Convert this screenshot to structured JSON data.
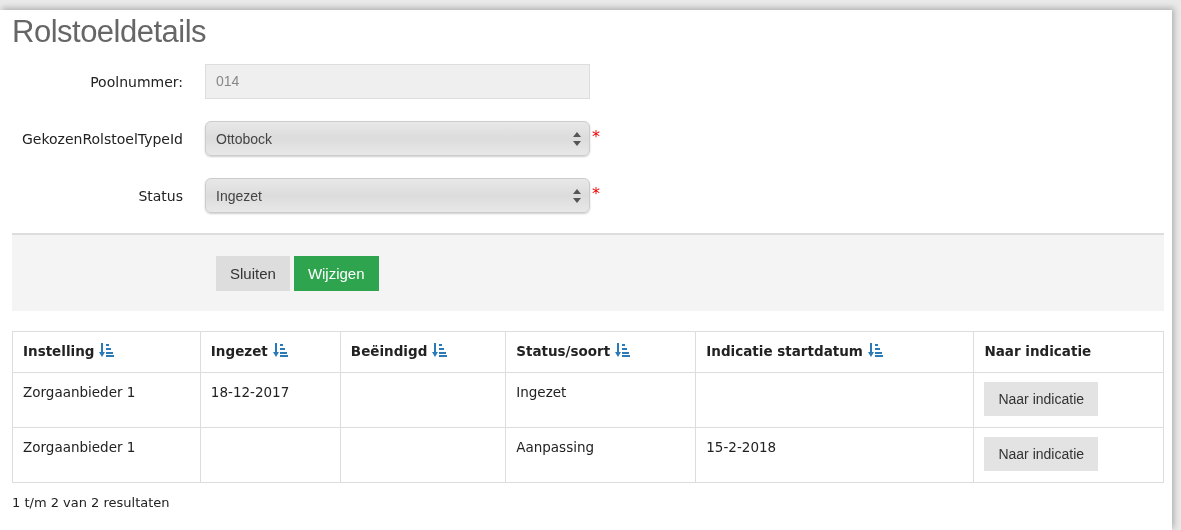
{
  "title": "Rolstoeldetails",
  "fields": [
    {
      "label": "Poolnummer:",
      "kind": "readonly",
      "value": "014"
    },
    {
      "label": "GekozenRolstoelTypeId",
      "kind": "select",
      "value": "Ottobock",
      "required_mark": "*"
    },
    {
      "label": "Status",
      "kind": "select",
      "value": "Ingezet",
      "required_mark": "*"
    }
  ],
  "buttons": [
    {
      "label": "Sluiten",
      "kind": "secondary"
    },
    {
      "label": "Wijzigen",
      "kind": "primary"
    }
  ],
  "table": {
    "columns": [
      {
        "label": "Instelling",
        "sortable": true
      },
      {
        "label": "Ingezet",
        "sortable": true
      },
      {
        "label": "Beëindigd",
        "sortable": true
      },
      {
        "label": "Status/soort",
        "sortable": true
      },
      {
        "label": "Indicatie startdatum",
        "sortable": true
      },
      {
        "label": "Naar indicatie",
        "sortable": false
      }
    ],
    "rows": [
      {
        "cells": [
          "Zorgaanbieder 1",
          "18-12-2017",
          "",
          "Ingezet",
          ""
        ],
        "button": "Naar indicatie"
      },
      {
        "cells": [
          "Zorgaanbieder 1",
          "",
          "",
          "Aanpassing",
          "15-2-2018"
        ],
        "button": "Naar indicatie"
      }
    ]
  },
  "summary": "1 t/m 2 van 2 resultaten"
}
